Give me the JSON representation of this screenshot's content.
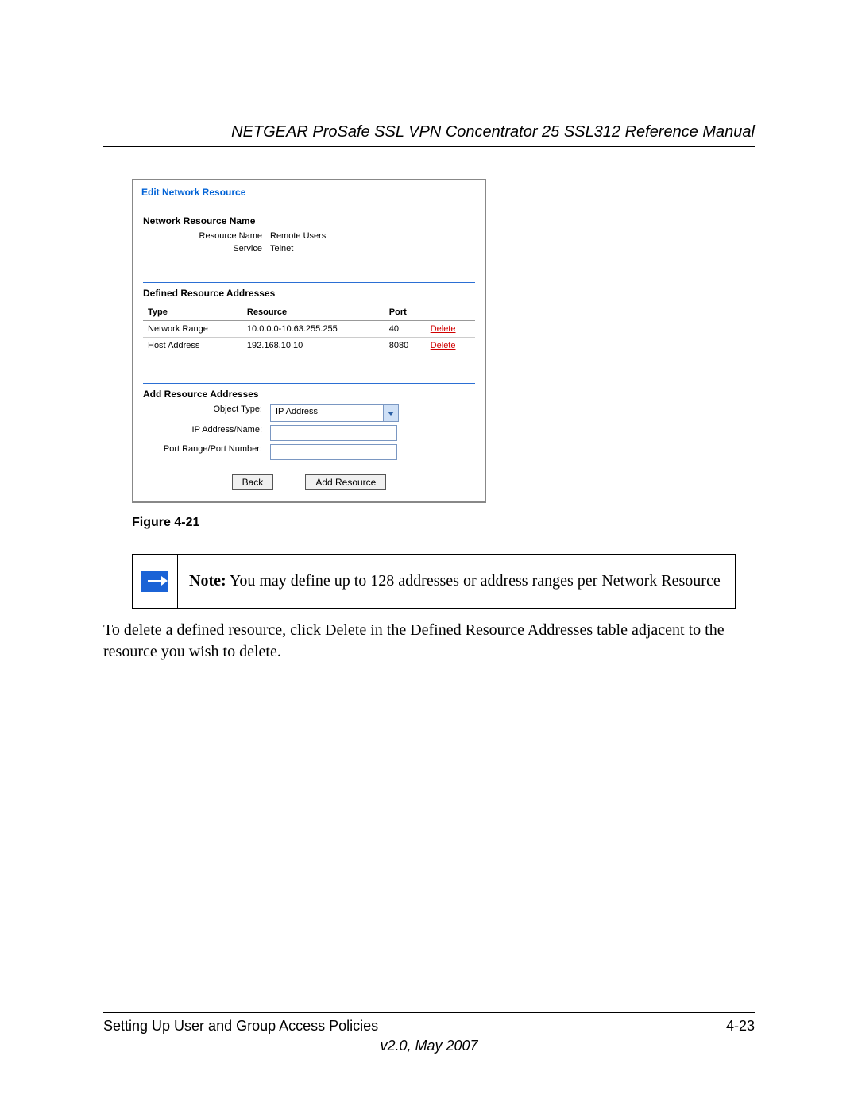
{
  "header": {
    "title": "NETGEAR ProSafe SSL VPN Concentrator 25 SSL312 Reference Manual"
  },
  "screenshot": {
    "title": "Edit Network Resource",
    "section1": {
      "heading": "Network Resource Name",
      "rows": [
        {
          "label": "Resource Name",
          "value": "Remote Users"
        },
        {
          "label": "Service",
          "value": "Telnet"
        }
      ]
    },
    "section2": {
      "heading": "Defined Resource Addresses",
      "columns": [
        "Type",
        "Resource",
        "Port",
        ""
      ],
      "rows": [
        {
          "type": "Network Range",
          "resource": "10.0.0.0-10.63.255.255",
          "port": "40",
          "action": "Delete"
        },
        {
          "type": "Host Address",
          "resource": "192.168.10.10",
          "port": "8080",
          "action": "Delete"
        }
      ]
    },
    "section3": {
      "heading": "Add Resource Addresses",
      "object_type_label": "Object Type:",
      "object_type_value": "IP Address",
      "ip_label": "IP Address/Name:",
      "port_label": "Port Range/Port Number:"
    },
    "buttons": {
      "back": "Back",
      "add": "Add Resource"
    }
  },
  "figure_caption": "Figure 4-21",
  "note": {
    "label": "Note:",
    "text": " You may define up to 128 addresses or address ranges per Network Resource"
  },
  "body": "To delete a defined resource, click Delete in the Defined Resource Addresses table adjacent to the resource you wish to delete.",
  "footer": {
    "left": "Setting Up User and Group Access Policies",
    "right": "4-23",
    "version": "v2.0, May 2007"
  }
}
